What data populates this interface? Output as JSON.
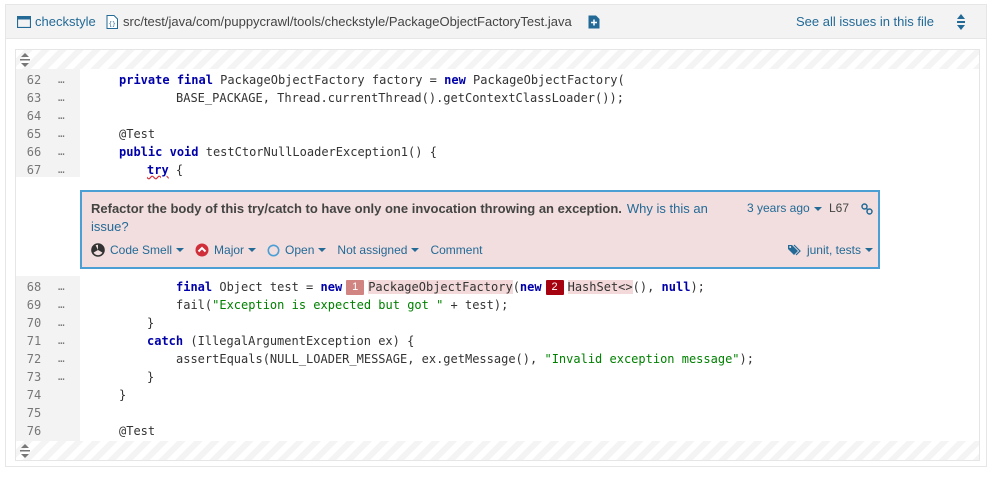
{
  "header": {
    "project": "checkstyle",
    "file_path": "src/test/java/com/puppycrawl/tools/checkstyle/PackageObjectFactoryTest.java",
    "see_all_issues": "See all issues in this file"
  },
  "lines_before": [
    {
      "num": "62",
      "dots": "…"
    },
    {
      "num": "63",
      "dots": "…"
    },
    {
      "num": "64",
      "dots": "…"
    },
    {
      "num": "65",
      "dots": "…"
    },
    {
      "num": "66",
      "dots": "…"
    },
    {
      "num": "67",
      "dots": "…"
    }
  ],
  "lines_after": [
    {
      "num": "68",
      "dots": "…"
    },
    {
      "num": "69",
      "dots": "…"
    },
    {
      "num": "70",
      "dots": "…"
    },
    {
      "num": "71",
      "dots": "…"
    },
    {
      "num": "72",
      "dots": "…"
    },
    {
      "num": "73",
      "dots": "…"
    },
    {
      "num": "74",
      "dots": ""
    },
    {
      "num": "75",
      "dots": ""
    },
    {
      "num": "76",
      "dots": ""
    }
  ],
  "code": {
    "l62": {
      "kw1": "private",
      "kw2": "final",
      "t1": " PackageObjectFactory factory = ",
      "kw3": "new",
      "t2": " PackageObjectFactory("
    },
    "l63": {
      "t1": "BASE_PACKAGE, Thread.currentThread().getContextClassLoader());"
    },
    "l65": {
      "ann": "@Test"
    },
    "l66": {
      "kw1": "public",
      "kw2": "void",
      "t1": " testCtorNullLoaderException1() {"
    },
    "l67": {
      "kw1": "try",
      "t1": " {"
    },
    "l68": {
      "kw1": "final",
      "t1": " Object test = ",
      "kw2": "new",
      "loc1": "1",
      "hl1": "PackageObjectFactory",
      "t2": "(",
      "kw3": "new",
      "loc2": "2",
      "hl2": "HashSet<>",
      "t3": "(), ",
      "kw4": "null",
      "t4": ");"
    },
    "l69": {
      "t1": "fail(",
      "str": "\"Exception is expected but got \"",
      "t2": " + test);"
    },
    "l70": {
      "t1": "}"
    },
    "l71": {
      "kw1": "catch",
      "t1": " (IllegalArgumentException ex) {"
    },
    "l72": {
      "t1": "assertEquals(NULL_LOADER_MESSAGE, ex.getMessage(), ",
      "str": "\"Invalid exception message\"",
      "t2": ");"
    },
    "l73": {
      "t1": "}"
    },
    "l74": {
      "t1": "}"
    },
    "l76": {
      "ann": "@Test"
    }
  },
  "issue": {
    "message": "Refactor the body of this try/catch to have only one invocation throwing an exception.",
    "why_link": "Why is this an issue?",
    "age": "3 years ago",
    "line": "L67",
    "type": "Code Smell",
    "severity": "Major",
    "status": "Open",
    "assignee": "Not assigned",
    "comment": "Comment",
    "tags": "junit, tests"
  },
  "colors": {
    "link": "#236a97",
    "issue_bg": "#f2dede",
    "issue_border": "#4b9fd5",
    "keyword": "#0000aa",
    "annotation": "#808000",
    "string": "#008000",
    "location_1": "#d18582",
    "location_2": "#a4030f",
    "severity_major": "#d02f3a"
  },
  "icons": {
    "project": "project-icon",
    "file": "file-icon",
    "new_tab": "open-in-new-tab-icon",
    "expand_all": "expand-all-icon",
    "expand": "expand-lines-icon",
    "code_smell": "code-smell-icon",
    "severity": "major-severity-icon",
    "status": "open-status-icon",
    "permalink": "link-icon",
    "tags": "tags-icon"
  }
}
